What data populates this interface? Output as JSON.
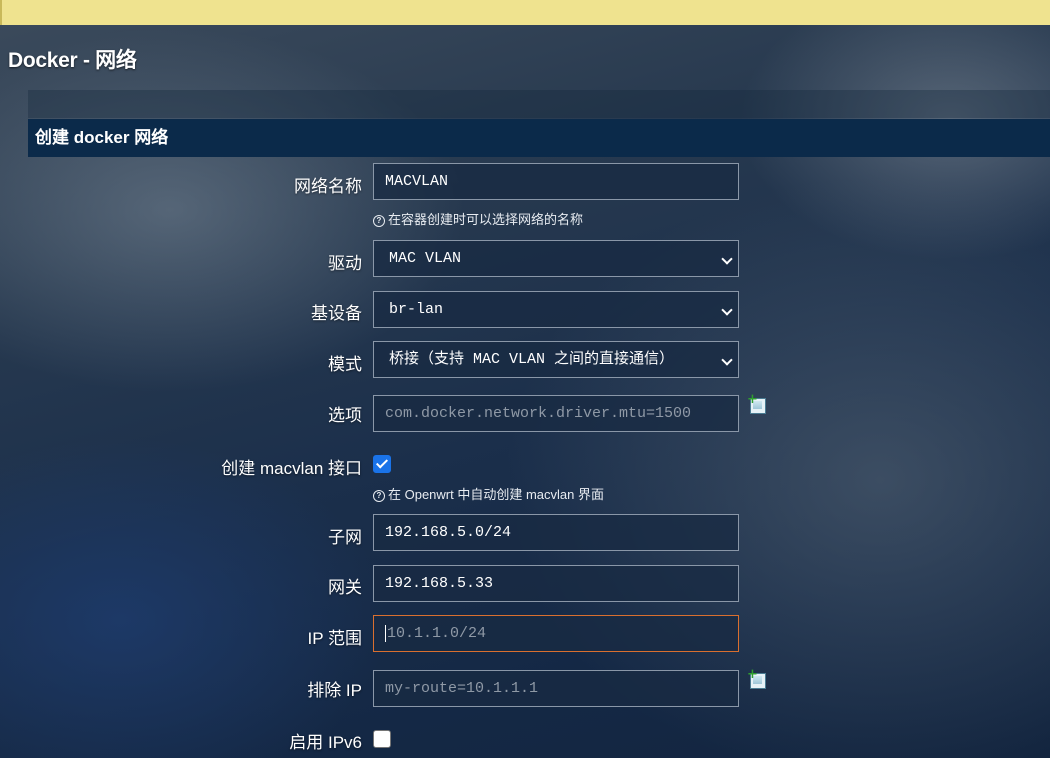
{
  "page": {
    "title": "Docker - 网络"
  },
  "section": {
    "title": "创建 docker 网络"
  },
  "form": {
    "network_name": {
      "label": "网络名称",
      "value": "MACVLAN",
      "help": "在容器创建时可以选择网络的名称"
    },
    "driver": {
      "label": "驱动",
      "value": "MAC VLAN"
    },
    "base_device": {
      "label": "基设备",
      "value": "br-lan"
    },
    "mode": {
      "label": "模式",
      "value": "桥接（支持 MAC VLAN 之间的直接通信）"
    },
    "options": {
      "label": "选项",
      "placeholder": "com.docker.network.driver.mtu=1500"
    },
    "create_macvlan": {
      "label": "创建 macvlan 接口",
      "checked": true,
      "help": "在 Openwrt 中自动创建 macvlan 界面"
    },
    "subnet": {
      "label": "子网",
      "value": "192.168.5.0/24"
    },
    "gateway": {
      "label": "网关",
      "value": "192.168.5.33"
    },
    "ip_range": {
      "label": "IP 范围",
      "placeholder": "10.1.1.0/24"
    },
    "exclude_ip": {
      "label": "排除 IP",
      "placeholder": "my-route=10.1.1.1"
    },
    "enable_ipv6": {
      "label": "启用 IPv6",
      "checked": false
    }
  },
  "icons": {
    "help": "question-circle-icon",
    "add": "add-entry-icon",
    "dropdown": "chevron-down-icon"
  },
  "colors": {
    "banner": "#efe38f",
    "section_header": "#0b2a4a",
    "checkbox_checked": "#1a73e8",
    "focus_border": "#d96f2f"
  }
}
